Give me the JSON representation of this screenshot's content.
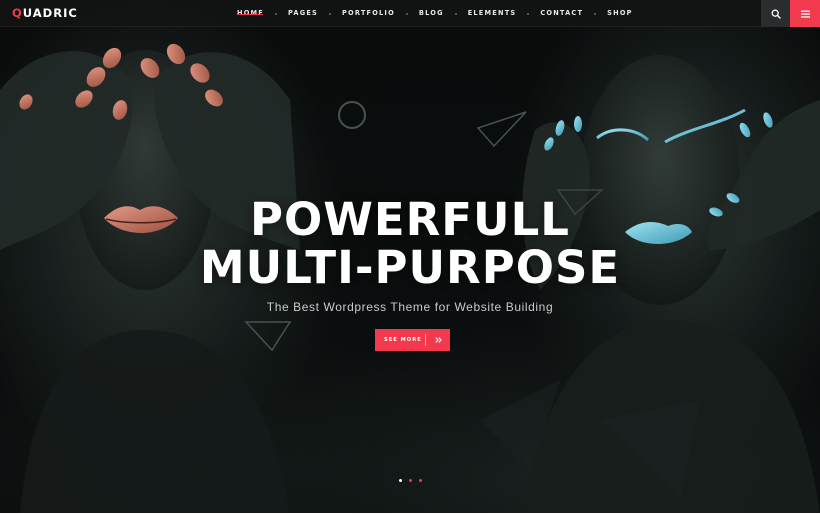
{
  "header": {
    "logo_first_letter": "Q",
    "logo_rest": "UADRIC",
    "nav": [
      {
        "label": "HOME",
        "active": true
      },
      {
        "label": "PAGES",
        "active": false
      },
      {
        "label": "PORTFOLIO",
        "active": false
      },
      {
        "label": "BLOG",
        "active": false
      },
      {
        "label": "ELEMENTS",
        "active": false
      },
      {
        "label": "CONTACT",
        "active": false
      },
      {
        "label": "SHOP",
        "active": false
      }
    ],
    "search_icon": "search-icon",
    "menu_icon": "hamburger-menu-icon"
  },
  "hero": {
    "headline_line1": "POWERFULL",
    "headline_line2": "MULTI-PURPOSE",
    "subtitle": "The Best Wordpress Theme for Website Building",
    "cta_label": "SEE MORE",
    "cta_icon": "double-chevron-right-icon",
    "slides_count": 3,
    "active_slide": 1,
    "background_image": "two painted-body models covering eyes and framing face with hands"
  },
  "colors": {
    "accent": "#f2394e",
    "header_bg": "#121414",
    "search_bg": "#2a2c2d",
    "text": "#ffffff"
  }
}
